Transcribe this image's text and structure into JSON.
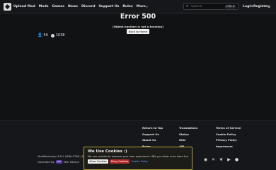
{
  "nav": {
    "items": [
      {
        "label": "Upload Mod"
      },
      {
        "label": "Mods"
      },
      {
        "label": "Games"
      },
      {
        "label": "News"
      },
      {
        "label": "Discord"
      },
      {
        "label": "Support Us"
      },
      {
        "label": "Rules"
      }
    ],
    "more_label": "More",
    "search_placeholder": "Search",
    "search_shortcut": "CTRL K",
    "login_label": "Login",
    "register_label": "Register"
  },
  "error": {
    "title": "Error 500",
    "message": "(Object.hasOwn is not a function)",
    "back_label": "Back to Home"
  },
  "stats": {
    "users": "59",
    "github": "1038"
  },
  "footer": {
    "col1": [
      "Return to Top",
      "Support Us",
      "About Us",
      "Rules"
    ],
    "col2": [
      "Translations",
      "Status",
      "Wiki",
      "API"
    ],
    "col3": [
      "Terms of Service",
      "Cookie Policy",
      "Privacy Policy",
      "Impressum"
    ],
    "version": "ModWorkshop 3.6.1 (MWv1786 | MWv",
    "operated_by": "Operated By",
    "operator_logo": "MW",
    "operator_name": "Milk Deluxe"
  },
  "cookie": {
    "title": "We Use Cookies :)",
    "text": "We use cookies to improve your user experience. Will you allow us to store them?",
    "allow_label": "Allow Cookies",
    "deny_label": "Deny Cookies",
    "policy_label": "Cookie Policy"
  },
  "icons": [
    "logo-icon",
    "chevron-down-icon",
    "search-icon",
    "user-icon",
    "github-icon",
    "discord-icon",
    "x-icon",
    "bluesky-icon",
    "youtube-icon"
  ]
}
